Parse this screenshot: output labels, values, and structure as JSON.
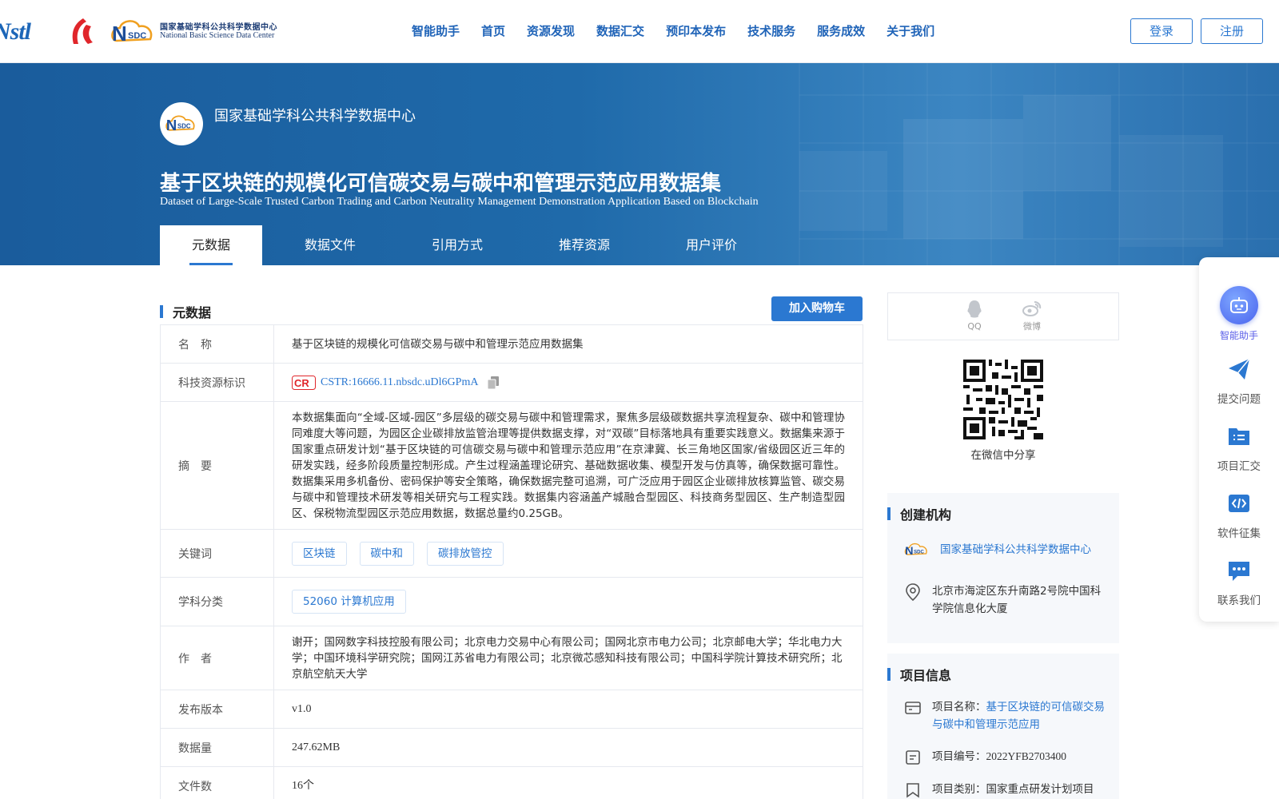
{
  "header": {
    "logo_nstl": "Nstl",
    "nsdc_cn": "国家基础学科公共科学数据中心",
    "nsdc_en": "National Basic Science Data Center",
    "nav": [
      "智能助手",
      "首页",
      "资源发现",
      "数据汇交",
      "预印本发布",
      "技术服务",
      "服务成效",
      "关于我们"
    ],
    "login": "登录",
    "register": "注册"
  },
  "banner": {
    "org_name": "国家基础学科公共科学数据中心",
    "title": "基于区块链的规模化可信碳交易与碳中和管理示范应用数据集",
    "title_en": "Dataset of Large-Scale Trusted Carbon Trading and Carbon Neutrality Management Demonstration Application Based on Blockchain",
    "tabs": [
      "元数据",
      "数据文件",
      "引用方式",
      "推荐资源",
      "用户评价"
    ],
    "active_tab": "元数据"
  },
  "metadata": {
    "section_title": "元数据",
    "cart_button": "加入购物车",
    "rows": {
      "name_label": "名　称",
      "name_value": "基于区块链的规模化可信碳交易与碳中和管理示范应用数据集",
      "cstr_label": "科技资源标识",
      "cstr_value": "CSTR:16666.11.nbsdc.uDl6GPmA",
      "abstract_label": "摘　要",
      "abstract_value": "本数据集面向“全域-区域-园区”多层级的碳交易与碳中和管理需求，聚焦多层级碳数据共享流程复杂、碳中和管理协同难度大等问题，为园区企业碳排放监管治理等提供数据支撑，对“双碳”目标落地具有重要实践意义。数据集来源于国家重点研发计划“基于区块链的可信碳交易与碳中和管理示范应用”在京津冀、长三角地区国家/省级园区近三年的研发实践，经多阶段质量控制形成。产生过程涵盖理论研究、基础数据收集、模型开发与仿真等，确保数据可靠性。数据集采用多机备份、密码保护等安全策略，确保数据完整可追溯，可广泛应用于园区企业碳排放核算监管、碳交易与碳中和管理技术研发等相关研究与工程实践。数据集内容涵盖产城融合型园区、科技商务型园区、生产制造型园区、保税物流型园区示范应用数据，数据总量约0.25GB。",
      "keywords_label": "关键词",
      "keywords": [
        "区块链",
        "碳中和",
        "碳排放管控"
      ],
      "subject_label": "学科分类",
      "subject_value": "52060 计算机应用",
      "authors_label": "作　者",
      "authors_value": "谢开；国网数字科技控股有限公司；北京电力交易中心有限公司；国网北京市电力公司；北京邮电大学；华北电力大学；中国环境科学研究院；国网江苏省电力有限公司；北京微芯感知科技有限公司；中国科学院计算技术研究所；北京航空航天大学",
      "version_label": "发布版本",
      "version_value": "v1.0",
      "size_label": "数据量",
      "size_value": "247.62MB",
      "files_label": "文件数",
      "files_value": "16个"
    }
  },
  "share": {
    "qq": "QQ",
    "weibo": "微博",
    "wechat_caption": "在微信中分享"
  },
  "creator": {
    "title": "创建机构",
    "org": "国家基础学科公共科学数据中心",
    "address": "北京市海淀区东升南路2号院中国科学院信息化大厦"
  },
  "project": {
    "title": "项目信息",
    "name_label": "项目名称：",
    "name_value": "基于区块链的可信碳交易与碳中和管理示范应用",
    "code_label": "项目编号：",
    "code_value": "2022YFB2703400",
    "type_label": "项目类别：",
    "type_value": "国家重点研发计划项目"
  },
  "sidebar": {
    "ai": "智能助手",
    "submit": "提交问题",
    "collect": "项目汇交",
    "software": "软件征集",
    "contact": "联系我们"
  },
  "colors": {
    "brand_blue": "#2b78d1",
    "banner_blue": "#1f6aaa"
  }
}
